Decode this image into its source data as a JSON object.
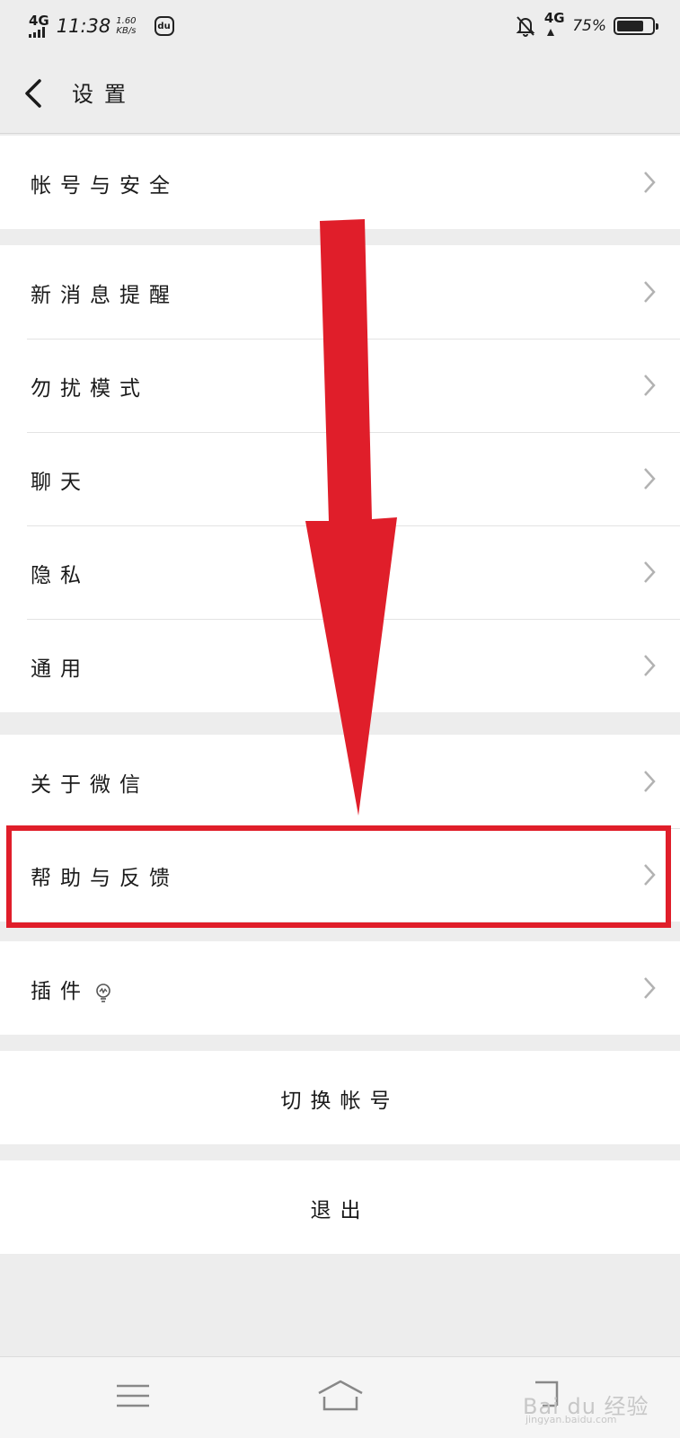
{
  "status_bar": {
    "network_left": "4G",
    "time": "11:38",
    "speed_value": "1.60",
    "speed_unit": "KB/s",
    "du_icon": "du",
    "network_right": "4G",
    "battery_percent": "75%",
    "battery_level": 0.75
  },
  "header": {
    "title": "设置"
  },
  "sections": {
    "account": {
      "label": "帐号与安全"
    },
    "notifications": {
      "label": "新消息提醒"
    },
    "dnd": {
      "label": "勿扰模式"
    },
    "chat": {
      "label": "聊天"
    },
    "privacy": {
      "label": "隐私"
    },
    "general": {
      "label": "通用"
    },
    "about": {
      "label": "关于微信"
    },
    "help": {
      "label": "帮助与反馈"
    },
    "plugins": {
      "label": "插件"
    }
  },
  "actions": {
    "switch_account": "切换帐号",
    "logout": "退出"
  },
  "watermark": {
    "brand": "Bai du 经验",
    "url": "jingyan.baidu.com"
  },
  "colors": {
    "accent_red": "#e01e2a",
    "background": "#ededed"
  }
}
